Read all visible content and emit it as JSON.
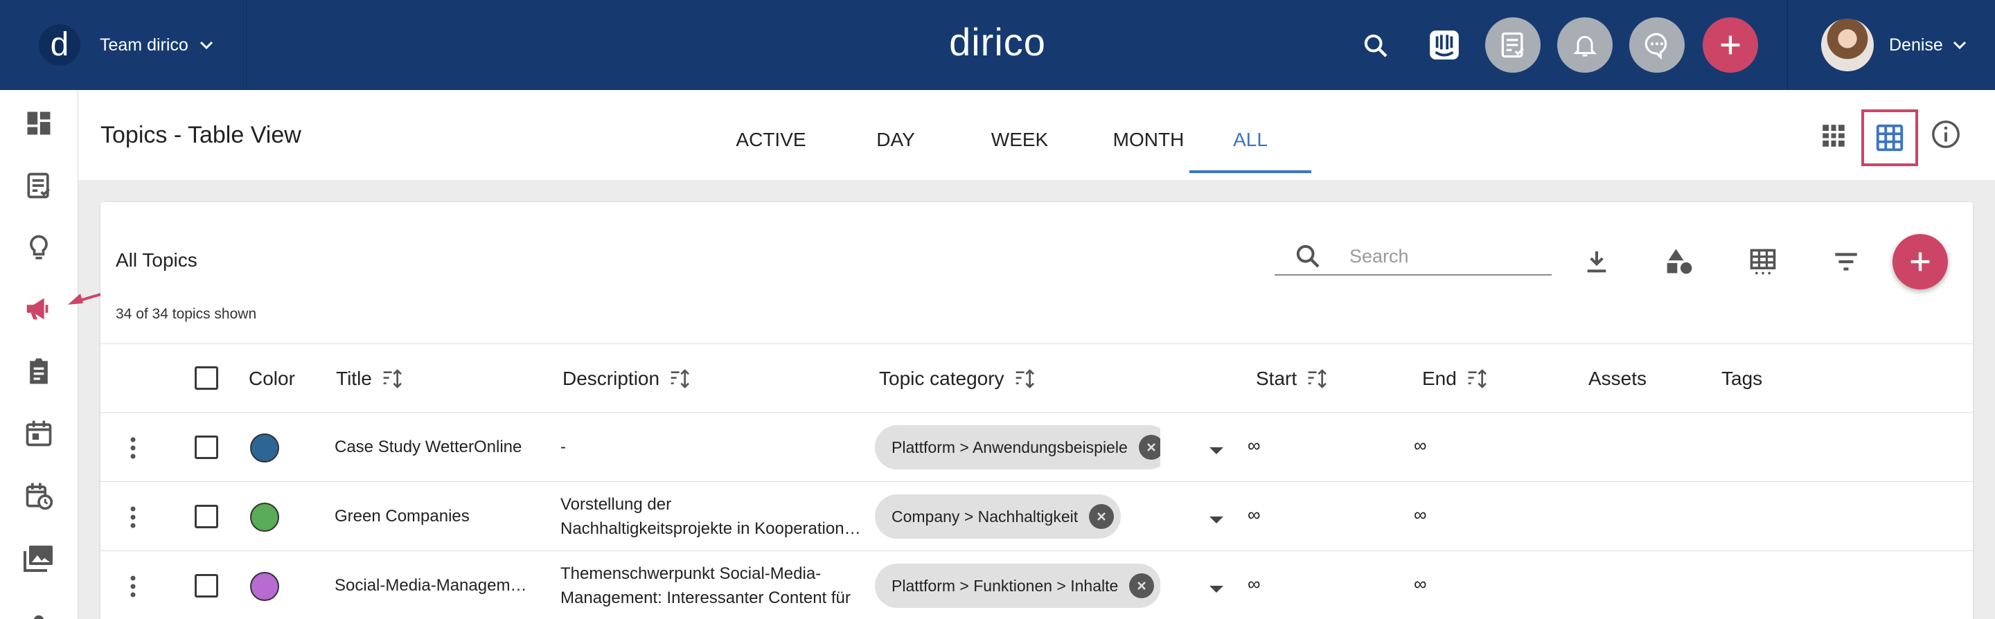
{
  "app": {
    "team_name": "Team dirico",
    "logo_letter": "d",
    "brand": "dirico",
    "user_name": "Denise"
  },
  "page": {
    "title": "Topics - Table View"
  },
  "tabs": [
    {
      "label": "ACTIVE"
    },
    {
      "label": "DAY"
    },
    {
      "label": "WEEK"
    },
    {
      "label": "MONTH"
    },
    {
      "label": "ALL",
      "active": true
    }
  ],
  "card": {
    "title": "All Topics",
    "count": "34 of 34 topics shown",
    "search_placeholder": "Search"
  },
  "table": {
    "columns": [
      "Color",
      "Title",
      "Description",
      "Topic category",
      "Start",
      "End",
      "Assets",
      "Tags"
    ],
    "rows": [
      {
        "color": "#2c6694",
        "title": "Case Study WetterOnline",
        "description": [
          "-"
        ],
        "category": "Plattform > Anwendungsbeispiele",
        "start": "∞",
        "end": "∞"
      },
      {
        "color": "#5aac56",
        "title": "Green Companies",
        "description": [
          "Vorstellung der",
          "Nachhaltigkeitsprojekte in Kooperation mit"
        ],
        "category": "Company > Nachhaltigkeit",
        "start": "∞",
        "end": "∞"
      },
      {
        "color": "#b76ad0",
        "title": "Social-Media-Management",
        "description": [
          "Themenschwerpunkt Social-Media-",
          "Management: Interessanter Content für"
        ],
        "category": "Plattform > Funktionen > Inhalte",
        "start": "∞",
        "end": "∞"
      }
    ]
  },
  "colors": {
    "topbar": "#163a70",
    "accent": "#cc4566",
    "active_tab": "#3a74c4"
  },
  "icons": [
    "chevron-down-icon",
    "search-icon",
    "intercom-icon",
    "tasks-icon",
    "bell-icon",
    "chat-icon",
    "plus-icon",
    "dashboard-icon",
    "checklist-icon",
    "lightbulb-icon",
    "megaphone-icon",
    "clipboard-icon",
    "calendar-icon",
    "calendar-clock-icon",
    "photos-icon",
    "grid-view-icon",
    "table-view-icon",
    "info-icon",
    "download-icon",
    "shapes-icon",
    "table-settings-icon",
    "filter-icon",
    "sort-icon",
    "kebab-icon",
    "close-icon"
  ]
}
